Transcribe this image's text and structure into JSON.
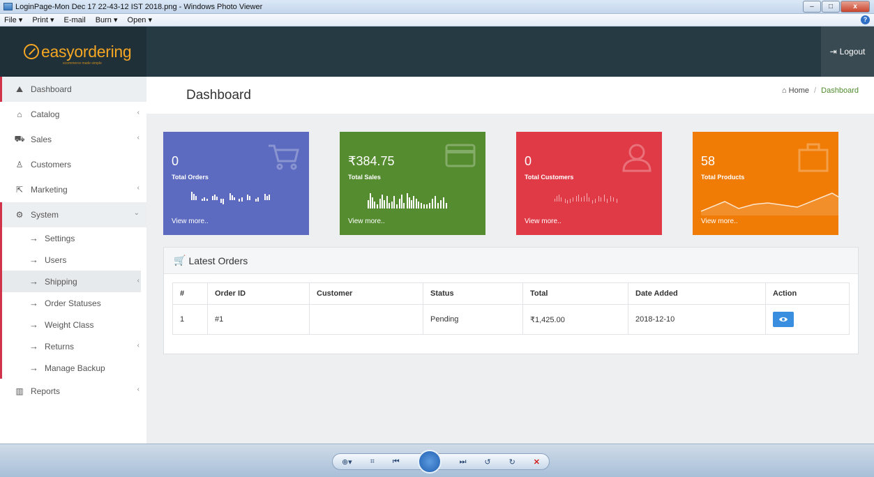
{
  "window": {
    "title": "LoginPage-Mon Dec 17 22-43-12 IST 2018.png - Windows Photo Viewer",
    "menu": [
      "File ▾",
      "Print ▾",
      "E-mail",
      "Burn ▾",
      "Open ▾"
    ],
    "controls": [
      "–",
      "□",
      "x"
    ],
    "help": "?"
  },
  "app": {
    "brand": "easyordering",
    "brand_tagline": "ecommerce made simple",
    "logout_label": "Logout",
    "accent_color": "#d0334a"
  },
  "sidebar": {
    "items": [
      {
        "label": "Dashboard",
        "icon": "dashboard-icon",
        "glyph": "⛰"
      },
      {
        "label": "Catalog",
        "icon": "tag-icon",
        "glyph": "⌂"
      },
      {
        "label": "Sales",
        "icon": "cart-icon",
        "glyph": "⛟"
      },
      {
        "label": "Customers",
        "icon": "user-icon",
        "glyph": "♙"
      },
      {
        "label": "Marketing",
        "icon": "share-icon",
        "glyph": "⇱"
      },
      {
        "label": "System",
        "icon": "gear-icon",
        "glyph": "⚙"
      },
      {
        "label": "Reports",
        "icon": "bar-chart-icon",
        "glyph": "▥"
      }
    ],
    "system_sub": [
      "Settings",
      "Users",
      "Shipping",
      "Order Statuses",
      "Weight Class",
      "Returns",
      "Manage Backup"
    ]
  },
  "header": {
    "title": "Dashboard",
    "breadcrumb_home": "Home",
    "breadcrumb_sep": "/",
    "breadcrumb_current": "Dashboard"
  },
  "cards": [
    {
      "value": "0",
      "label": "Total Orders",
      "more": "View more..",
      "color": "#5c6bc0"
    },
    {
      "value": "₹384.75",
      "label": "Total Sales",
      "more": "View more..",
      "color": "#548c2f"
    },
    {
      "value": "0",
      "label": "Total Customers",
      "more": "View more..",
      "color": "#e03a46"
    },
    {
      "value": "58",
      "label": "Total Products",
      "more": "View more..",
      "color": "#f07c05"
    }
  ],
  "orders": {
    "title": "Latest Orders",
    "columns": [
      "#",
      "Order ID",
      "Customer",
      "Status",
      "Total",
      "Date Added",
      "Action"
    ],
    "rows": [
      {
        "num": "1",
        "order_id": "#1",
        "customer": "",
        "status": "Pending",
        "total": "₹1,425.00",
        "date": "2018-12-10"
      }
    ]
  }
}
